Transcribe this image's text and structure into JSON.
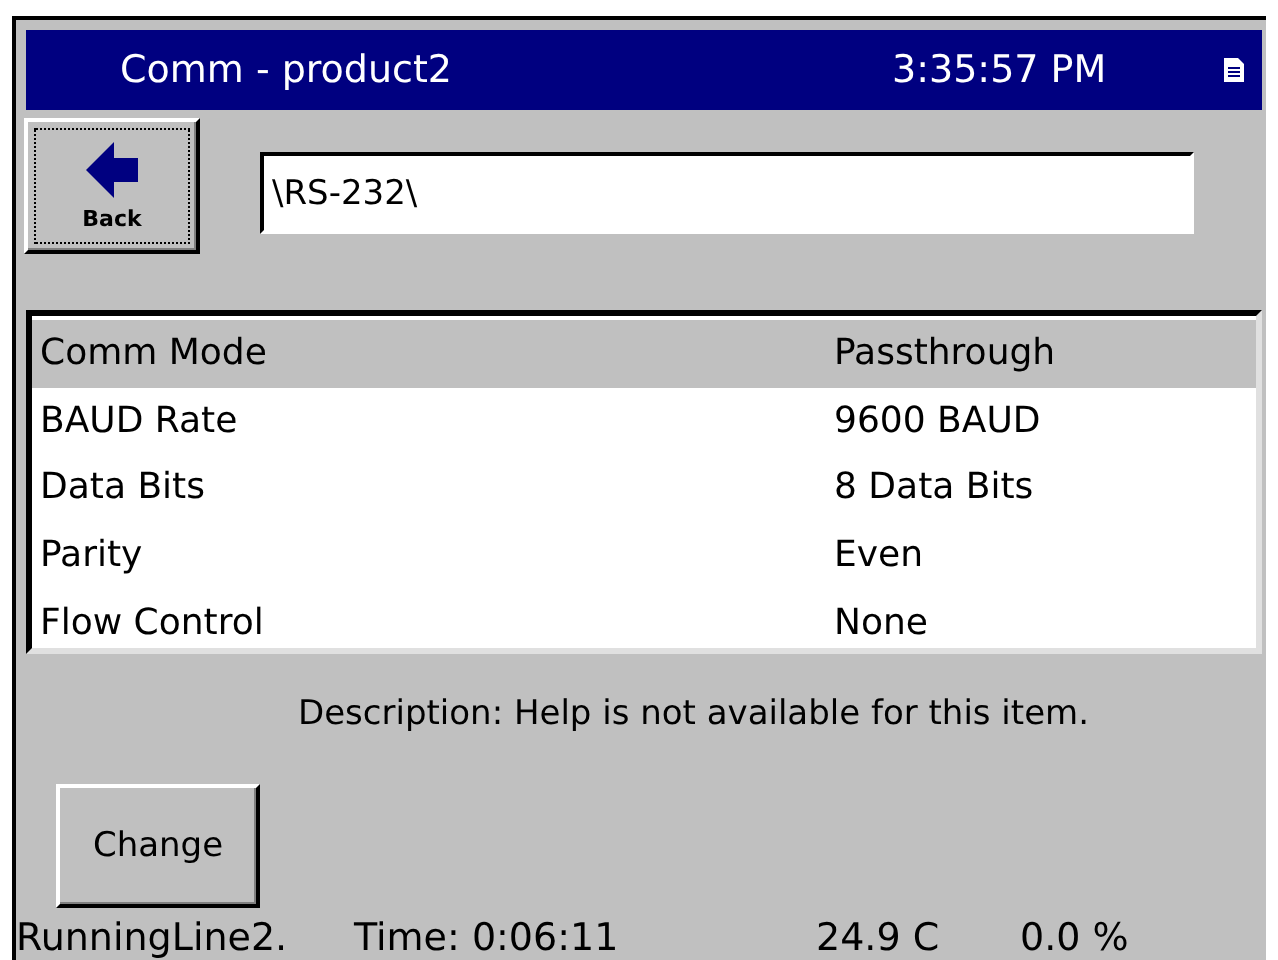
{
  "window": {
    "title": "Comm - product2",
    "time": "3:35:57 PM"
  },
  "back_button": {
    "label": "Back"
  },
  "path_field": {
    "value": "\\RS-232\\"
  },
  "settings": [
    {
      "name": "Comm Mode",
      "value": "Passthrough",
      "selected": true
    },
    {
      "name": "BAUD Rate",
      "value": "9600 BAUD",
      "selected": false
    },
    {
      "name": "Data Bits",
      "value": "8 Data Bits",
      "selected": false
    },
    {
      "name": "Parity",
      "value": "Even",
      "selected": false
    },
    {
      "name": "Flow Control",
      "value": "None",
      "selected": false
    }
  ],
  "description": "Description:  Help is not available for this item.",
  "change_button": {
    "label": "Change"
  },
  "status_bar": {
    "line": "RunningLine2.",
    "time": "Time: 0:06:11",
    "temperature": "24.9 C",
    "percent": "0.0 %"
  }
}
